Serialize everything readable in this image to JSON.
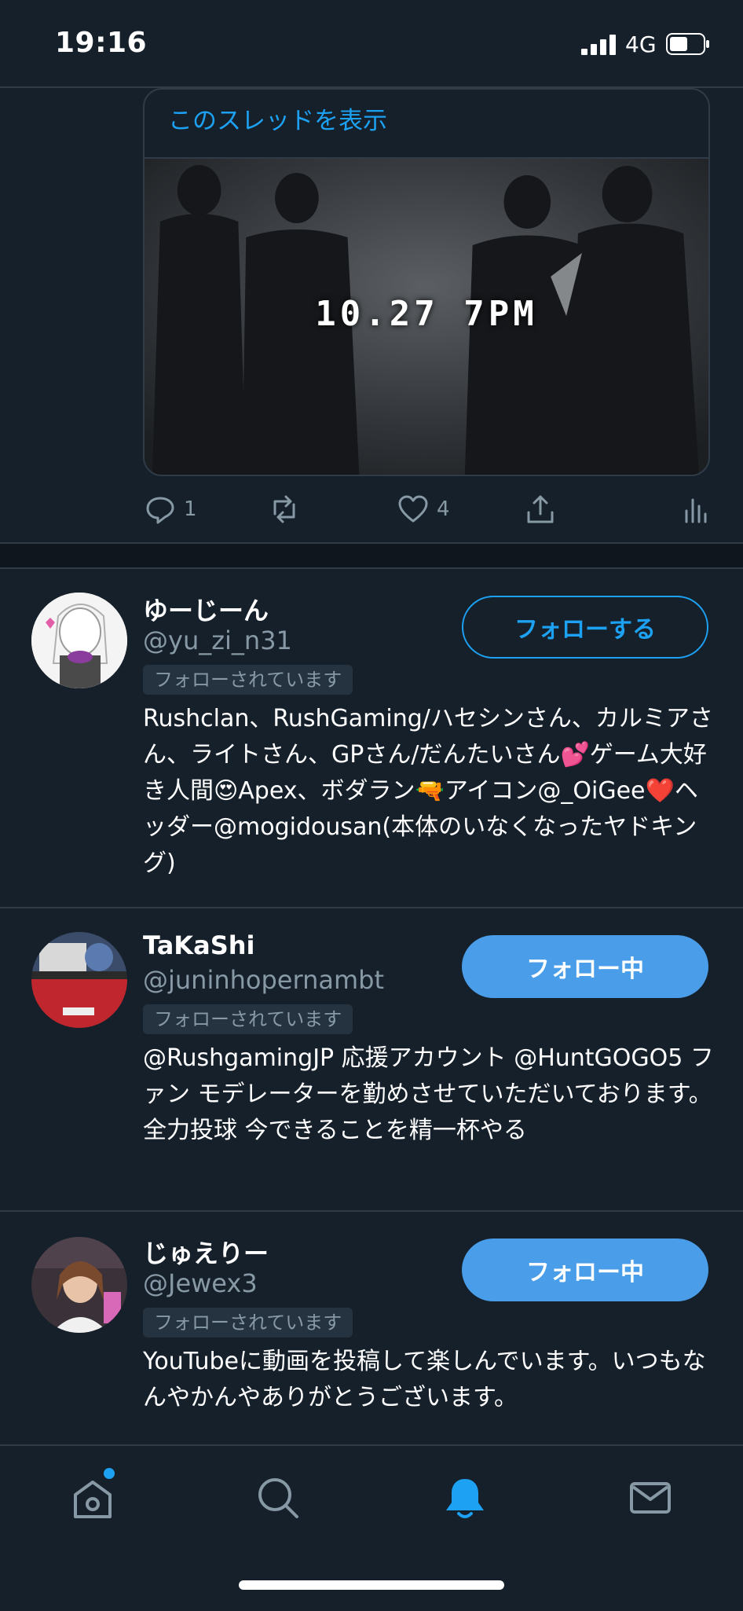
{
  "status_bar": {
    "time": "19:16",
    "network": "4G"
  },
  "tweet": {
    "thread_link": "このスレッドを表示",
    "media_text": "10.27 7PM",
    "actions": {
      "reply_count": "1",
      "like_count": "4"
    }
  },
  "users": [
    {
      "name": "ゆーじーん",
      "handle": "@yu_zi_n31",
      "follows_you": "フォローされています",
      "button": "フォローする",
      "bio": "Rushclan、RushGaming/ハセシンさん、カルミアさん、ライトさん、GPさん/だんたいさん💕ゲーム大好き人間😍Apex、ボダラン🔫アイコン@_OiGee❤️ヘッダー@mogidousan(本体のいなくなったヤドキング)"
    },
    {
      "name": "TaKaShi",
      "handle": "@juninhopernambt",
      "follows_you": "フォローされています",
      "button": "フォロー中",
      "bio": "@RushgamingJP 応援アカウント @HuntGOGO5 ファン モデレーターを勤めさせていただいております。全力投球 今できることを精一杯やる"
    },
    {
      "name": "じゅえりー",
      "handle": "@Jewex3",
      "follows_you": "フォローされています",
      "button": "フォロー中",
      "bio": "YouTubeに動画を投稿して楽しんでいます。いつもなんやかんやありがとうございます。"
    }
  ],
  "tabbar": {
    "tabs": [
      "home-icon",
      "search-icon",
      "notifications-icon",
      "messages-icon"
    ],
    "active": "notifications-icon"
  },
  "colors": {
    "background": "#15202b",
    "accent": "#1da1f2",
    "muted": "#8899a6",
    "follow_fill": "#4a9de8"
  }
}
